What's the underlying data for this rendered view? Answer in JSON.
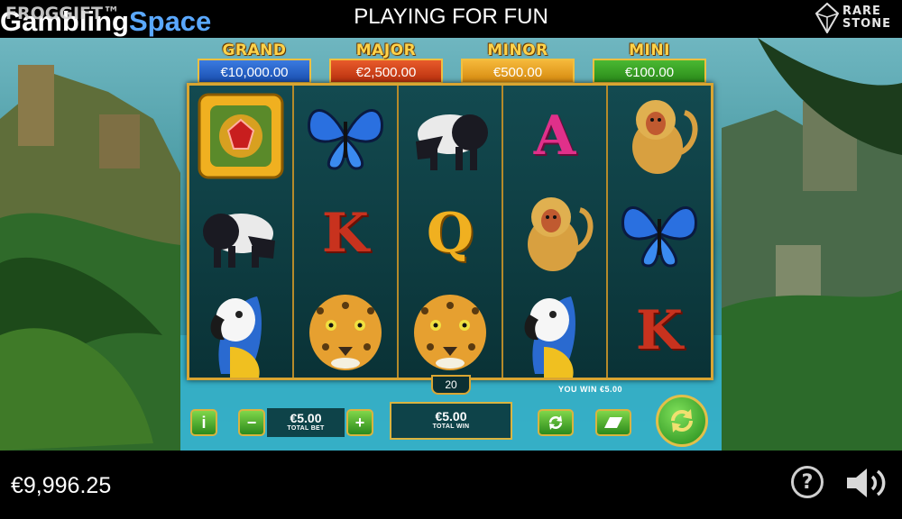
{
  "header": {
    "brand_overlay": "FROGGIFT™",
    "brand_word1": "Gambling",
    "brand_word2": "Space",
    "mode_title": "PLAYING FOR FUN",
    "provider_line1": "RARE",
    "provider_line2": "STONE"
  },
  "jackpots": [
    {
      "label": "GRAND",
      "value": "€10,000.00",
      "color": "#1f5fc8"
    },
    {
      "label": "MAJOR",
      "value": "€2,500.00",
      "color": "#d2401c"
    },
    {
      "label": "MINOR",
      "value": "€500.00",
      "color": "#e9a21a"
    },
    {
      "label": "MINI",
      "value": "€100.00",
      "color": "#2f9a1e"
    }
  ],
  "reels": [
    [
      "gem-scatter-icon",
      "tapir-icon",
      "parrot-icon"
    ],
    [
      "butterfly-icon",
      "K",
      "jaguar-icon"
    ],
    [
      "tapir-icon",
      "Q",
      "jaguar-icon"
    ],
    [
      "A",
      "monkey-icon",
      "parrot-icon"
    ],
    [
      "monkey-icon",
      "butterfly-icon",
      "K"
    ]
  ],
  "game": {
    "lines": "20",
    "you_win": "YOU WIN €5.00",
    "bet_value": "€5.00",
    "bet_label": "TOTAL BET",
    "win_value": "€5.00",
    "win_label": "TOTAL WIN",
    "info_label": "i",
    "minus_label": "−",
    "plus_label": "+"
  },
  "footer": {
    "balance": "€9,996.25",
    "help_label": "?"
  },
  "colors": {
    "frame_gold": "#d9a532",
    "button_green": "#3aa024",
    "letter_red": "#c8321e",
    "letter_gold": "#f0b020",
    "letter_pink": "#e0308a"
  }
}
